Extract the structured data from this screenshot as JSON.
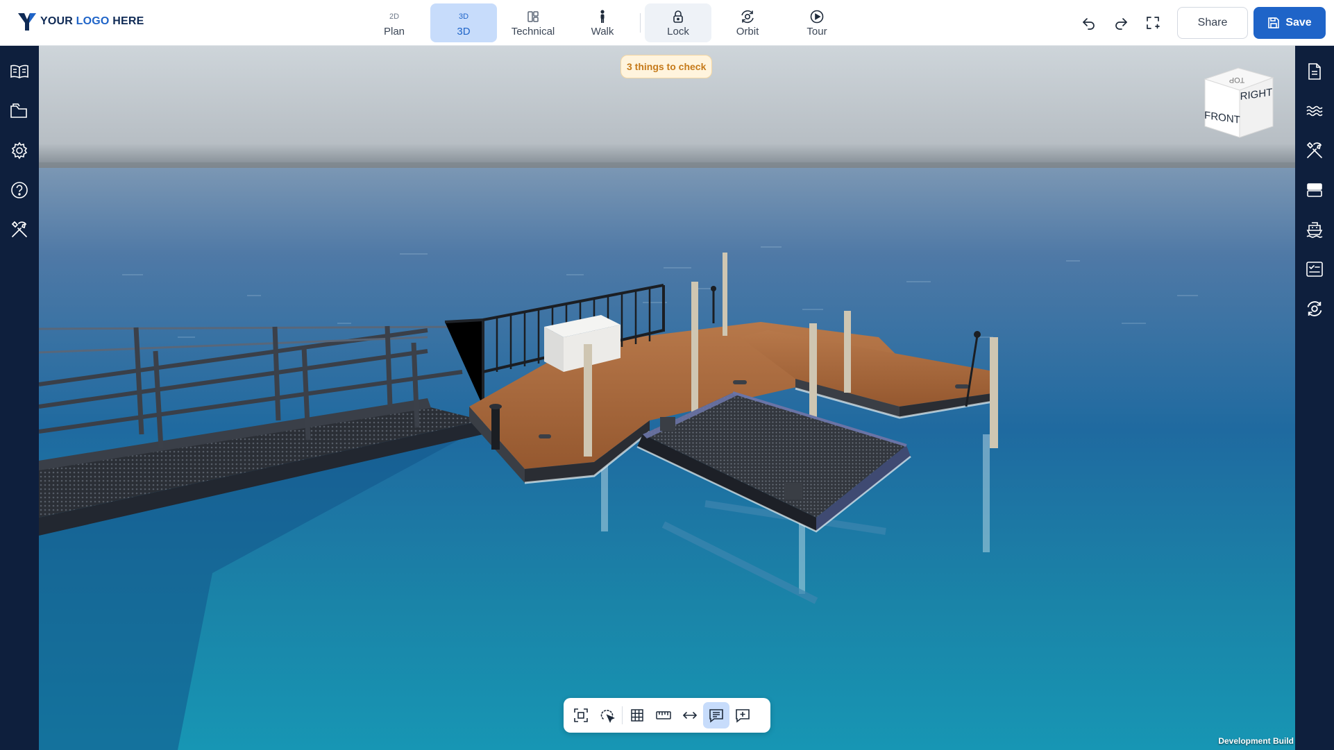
{
  "brand": {
    "logo_part1": "YOUR ",
    "logo_part2": "LOGO",
    "logo_part3": " HERE",
    "accent": "#1f64c8",
    "dark": "#0e1f3d"
  },
  "view_modes": [
    {
      "icon_text": "2D",
      "label": "Plan",
      "state": "normal"
    },
    {
      "icon_text": "3D",
      "label": "3D",
      "state": "active"
    },
    {
      "icon": "layout-icon",
      "label": "Technical",
      "state": "normal"
    },
    {
      "icon": "walk-person-icon",
      "label": "Walk",
      "state": "normal"
    },
    {
      "icon": "lock-icon",
      "label": "Lock",
      "state": "soft"
    },
    {
      "icon": "orbit-icon",
      "label": "Orbit",
      "state": "normal"
    },
    {
      "icon": "play-circle-icon",
      "label": "Tour",
      "state": "normal"
    }
  ],
  "actions": {
    "undo_icon": "undo-icon",
    "redo_icon": "redo-icon",
    "fullscreen_icon": "fullscreen-icon",
    "share_label": "Share",
    "save_label": "Save"
  },
  "notice": {
    "text": "3 things to check",
    "bg": "#fff4dd",
    "color": "#c57a1a"
  },
  "viewcube": {
    "top": "TOP",
    "front": "FRONT",
    "right": "RIGHT"
  },
  "left_sidebar": [
    {
      "icon": "book-open-icon"
    },
    {
      "icon": "folder-icon"
    },
    {
      "icon": "settings-gear-icon"
    },
    {
      "icon": "help-circle-icon"
    },
    {
      "icon": "tools-icon"
    }
  ],
  "right_sidebar": [
    {
      "icon": "document-icon"
    },
    {
      "icon": "water-waves-icon"
    },
    {
      "icon": "tools-icon"
    },
    {
      "icon": "layout-rows-icon"
    },
    {
      "icon": "boat-icon"
    },
    {
      "icon": "checklist-icon"
    },
    {
      "icon": "orbit-icon"
    }
  ],
  "bottom_tools": [
    {
      "icon": "focus-select-icon",
      "active": false
    },
    {
      "icon": "lasso-select-icon",
      "active": false
    },
    {
      "icon": "grid-icon",
      "active": false
    },
    {
      "icon": "ruler-icon",
      "active": false
    },
    {
      "icon": "arrows-horizontal-icon",
      "active": false
    },
    {
      "icon": "comment-list-icon",
      "active": true
    },
    {
      "icon": "comment-add-icon",
      "active": false
    }
  ],
  "footer": {
    "build_label": "Development Build"
  }
}
